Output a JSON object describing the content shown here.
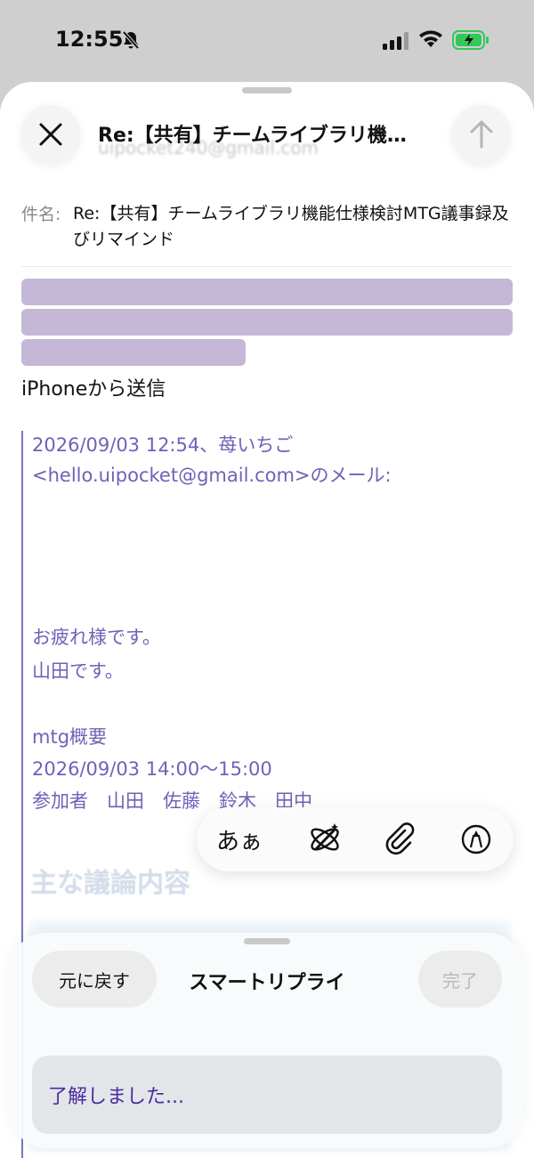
{
  "status_bar": {
    "time": "12:55",
    "icons": [
      "bell-slash-icon",
      "cellular-signal-icon",
      "wifi-icon",
      "battery-charging-icon"
    ]
  },
  "compose": {
    "header_subject": "Re:【共有】チームライブラリ機…",
    "faded_from": "uipocket240@gmail.com",
    "subject_label": "件名:",
    "subject_value": "Re:【共有】チームライブラリ機能仕様検討MTG議事録及びリマインド",
    "signature": "iPhoneから送信",
    "quoted": {
      "header_line1": "2026/09/03 12:54、苺いちご",
      "header_line2": "<hello.uipocket@gmail.com>のメール:",
      "greeting1": "お疲れ様です。",
      "greeting2": "山田です。",
      "overview_title": "mtg概要",
      "overview_time": "2026/09/03 14:00〜15:00",
      "attendees": "参加者　山田　佐藤　鈴木　田中",
      "section_heading": "主な議論内容"
    }
  },
  "format_toolbar": {
    "text_style_label": "あぁ",
    "icons": [
      "writing-tools-icon",
      "paperclip-icon",
      "markup-pen-icon"
    ]
  },
  "smart_reply": {
    "undo_label": "元に戻す",
    "title": "スマートリプライ",
    "done_label": "完了",
    "suggestion": "了解しました..."
  },
  "colors": {
    "quote_text": "#6c63b8",
    "quote_bar": "#7a74c8",
    "redaction": "#c4b8d6",
    "battery_green": "#34c759",
    "suggestion_text": "#4b2a9e"
  }
}
